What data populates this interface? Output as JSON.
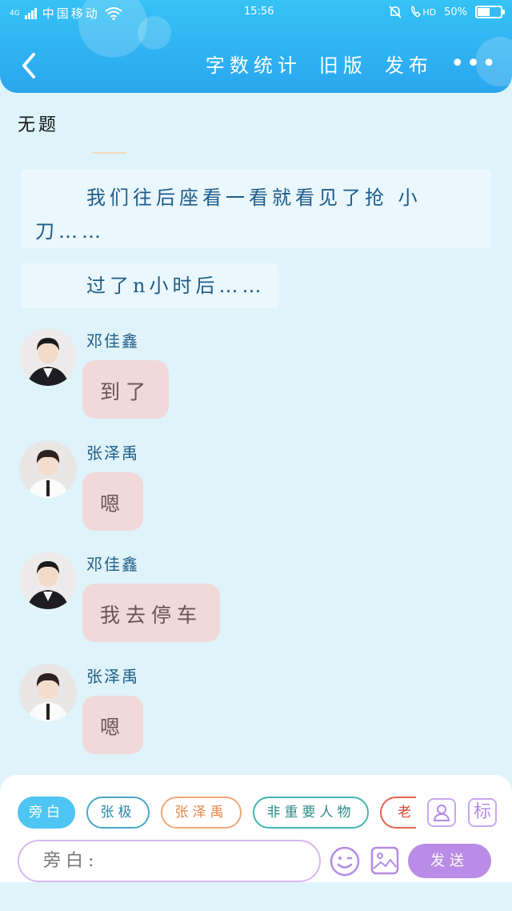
{
  "status_bar": {
    "network": "4G",
    "carrier": "中国移动",
    "time": "15:56",
    "hd_label": "HD",
    "battery": "50%",
    "battery_level": 0.5
  },
  "header": {
    "actions": [
      "字数统计",
      "旧版",
      "发布"
    ],
    "more": "•••"
  },
  "document": {
    "title": "无题"
  },
  "narrations": [
    "我们往后座看一看就看见了抢 小刀……",
    "过了n小时后……"
  ],
  "messages": [
    {
      "name": "邓佳鑫",
      "text": "到了"
    },
    {
      "name": "张泽禹",
      "text": "嗯"
    },
    {
      "name": "邓佳鑫",
      "text": "我去停车"
    },
    {
      "name": "张泽禹",
      "text": "嗯"
    }
  ],
  "toolbar": {
    "roles": [
      "旁白",
      "张极",
      "张泽禹",
      "非重要人物",
      "老"
    ],
    "tag_icon_label": "标",
    "input_placeholder": "旁白:",
    "send_label": "发送"
  },
  "colors": {
    "header_gradient_top": "#36c2f5",
    "header_gradient_bottom": "#2aa6ef",
    "background": "#dff3fb",
    "bubble": "#f1d8d9",
    "send_button": "#b98de7"
  }
}
